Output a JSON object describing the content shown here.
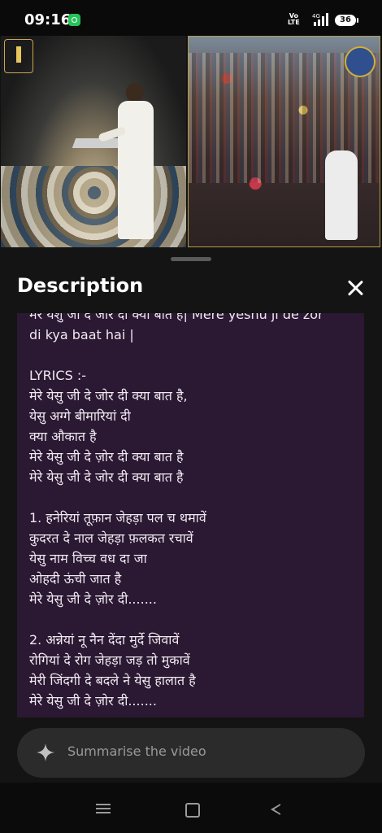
{
  "status_bar": {
    "time": "09:16",
    "network_label_top": "Vo",
    "network_label_bottom": "LTE",
    "network_type": "4G",
    "battery": "36",
    "icons": [
      "whatsapp-icon",
      "volte-icon",
      "signal-icon",
      "battery-icon"
    ]
  },
  "video": {
    "left_pane": "stage-camera",
    "right_pane": "crowd-camera"
  },
  "sheet": {
    "title": "Description",
    "close_icon": "close-icon",
    "description_lines": [
      "मेरे येशु जी दे जोर दी क्या बात है| Mere yeshu ji de zor",
      "di kya baat hai |",
      "",
      "LYRICS :-",
      "मेरे येसु जी दे जोर दी क्या बात है,",
      "येसु अग्गे बीमारियां दी",
      "क्या औकात है",
      "मेरे येसु जी दे ज़ोर दी क्या बात है",
      "मेरे येसु जी दे जोर दी क्या बात है",
      "",
      "1. हनेरियां तूफ़ान जेहड़ा पल च थमावें",
      "कुदरत दे नाल जेहड़ा फ़लकत रचावें",
      "येसु नाम विच्च वध दा जा",
      "ओहदी ऊंची जात है",
      "मेरे येसु जी दे  ज़ोर दी.......",
      "",
      "2. अन्नेयां नू नैन देंदा मुर्दे जिवावें",
      "रोगियां दे रोग जेहड़ा जड़ तो मुकावें",
      "मेरी जिंदगी दे बदले ने येसु  हालात है",
      "मेरे येसु जी दे ज़ोर दी......."
    ]
  },
  "composer": {
    "placeholder": "Summarise the video",
    "icon": "sparkle-icon"
  },
  "nav_bar": {
    "icons": [
      "menu-icon",
      "home-icon",
      "back-icon"
    ]
  },
  "colors": {
    "background": "#141414",
    "description_box": "#2b1832",
    "composer": "#2b2b2b",
    "whatsapp_green": "#27c25a"
  }
}
